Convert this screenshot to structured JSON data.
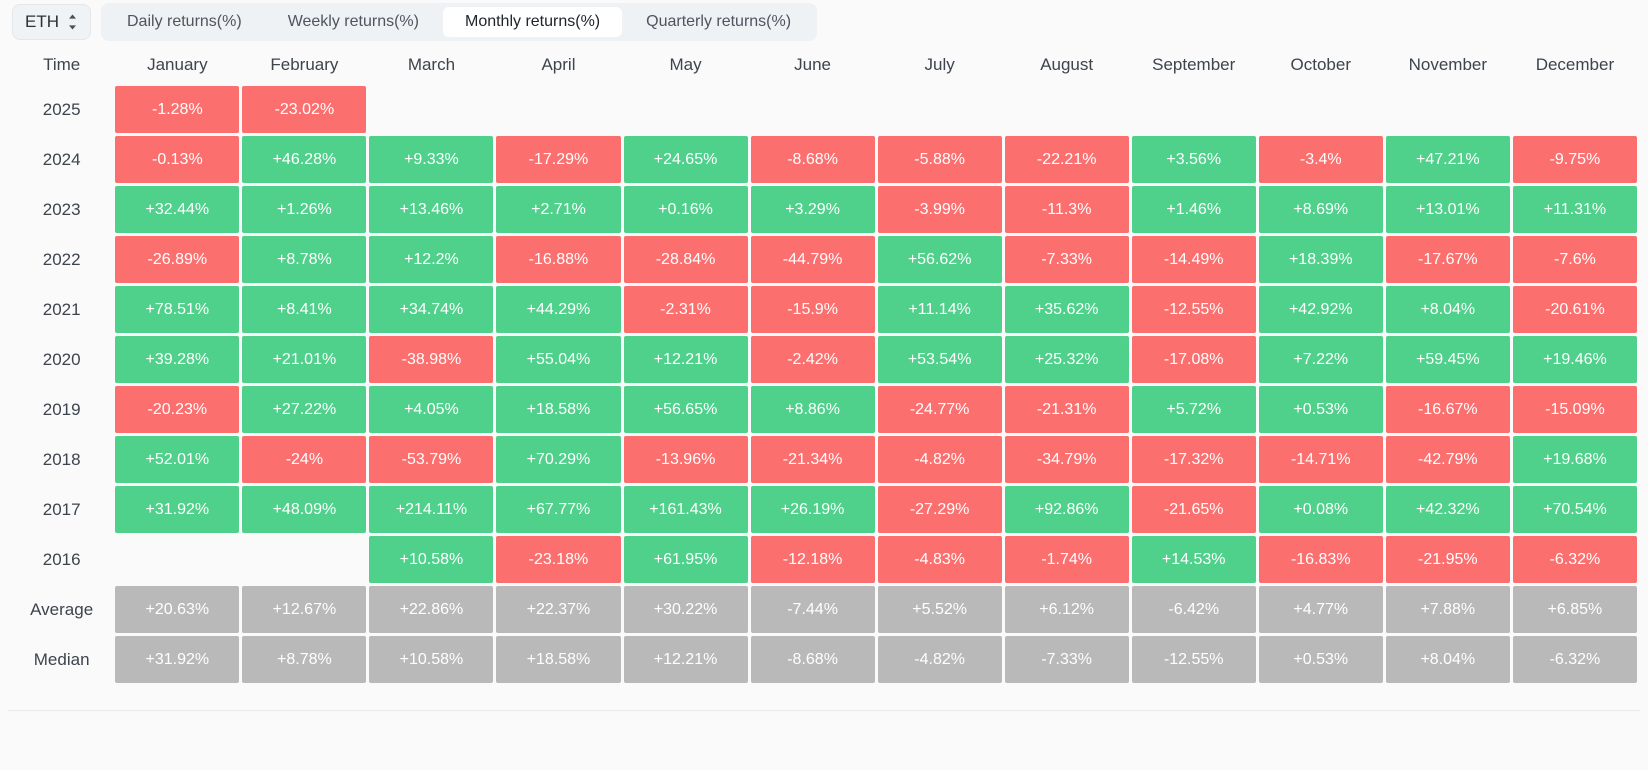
{
  "toolbar": {
    "symbol": "ETH",
    "symbol_caret_icon": "chevron-up-down-icon",
    "tabs": [
      {
        "label": "Daily returns(%)",
        "active": false
      },
      {
        "label": "Weekly returns(%)",
        "active": false
      },
      {
        "label": "Monthly returns(%)",
        "active": true
      },
      {
        "label": "Quarterly returns(%)",
        "active": false
      }
    ]
  },
  "colors": {
    "positive": "#4fd18b",
    "negative": "#fb6f6f",
    "stat": "#b9b9b9",
    "page_bg": "#fafafa",
    "tabs_bg": "#eef2f4",
    "text": "#3d444d"
  },
  "chart_data": {
    "type": "heatmap",
    "title": "Monthly returns(%)",
    "xlabel": "",
    "ylabel": "Time",
    "time_header": "Time",
    "categories": [
      "January",
      "February",
      "March",
      "April",
      "May",
      "June",
      "July",
      "August",
      "September",
      "October",
      "November",
      "December"
    ],
    "rows": [
      {
        "label": "2025",
        "kind": "year",
        "values": [
          "-1.28%",
          "-23.02%",
          "",
          "",
          "",
          "",
          "",
          "",
          "",
          "",
          "",
          ""
        ]
      },
      {
        "label": "2024",
        "kind": "year",
        "values": [
          "-0.13%",
          "+46.28%",
          "+9.33%",
          "-17.29%",
          "+24.65%",
          "-8.68%",
          "-5.88%",
          "-22.21%",
          "+3.56%",
          "-3.4%",
          "+47.21%",
          "-9.75%"
        ]
      },
      {
        "label": "2023",
        "kind": "year",
        "values": [
          "+32.44%",
          "+1.26%",
          "+13.46%",
          "+2.71%",
          "+0.16%",
          "+3.29%",
          "-3.99%",
          "-11.3%",
          "+1.46%",
          "+8.69%",
          "+13.01%",
          "+11.31%"
        ]
      },
      {
        "label": "2022",
        "kind": "year",
        "values": [
          "-26.89%",
          "+8.78%",
          "+12.2%",
          "-16.88%",
          "-28.84%",
          "-44.79%",
          "+56.62%",
          "-7.33%",
          "-14.49%",
          "+18.39%",
          "-17.67%",
          "-7.6%"
        ]
      },
      {
        "label": "2021",
        "kind": "year",
        "values": [
          "+78.51%",
          "+8.41%",
          "+34.74%",
          "+44.29%",
          "-2.31%",
          "-15.9%",
          "+11.14%",
          "+35.62%",
          "-12.55%",
          "+42.92%",
          "+8.04%",
          "-20.61%"
        ]
      },
      {
        "label": "2020",
        "kind": "year",
        "values": [
          "+39.28%",
          "+21.01%",
          "-38.98%",
          "+55.04%",
          "+12.21%",
          "-2.42%",
          "+53.54%",
          "+25.32%",
          "-17.08%",
          "+7.22%",
          "+59.45%",
          "+19.46%"
        ]
      },
      {
        "label": "2019",
        "kind": "year",
        "values": [
          "-20.23%",
          "+27.22%",
          "+4.05%",
          "+18.58%",
          "+56.65%",
          "+8.86%",
          "-24.77%",
          "-21.31%",
          "+5.72%",
          "+0.53%",
          "-16.67%",
          "-15.09%"
        ]
      },
      {
        "label": "2018",
        "kind": "year",
        "values": [
          "+52.01%",
          "-24%",
          "-53.79%",
          "+70.29%",
          "-13.96%",
          "-21.34%",
          "-4.82%",
          "-34.79%",
          "-17.32%",
          "-14.71%",
          "-42.79%",
          "+19.68%"
        ]
      },
      {
        "label": "2017",
        "kind": "year",
        "values": [
          "+31.92%",
          "+48.09%",
          "+214.11%",
          "+67.77%",
          "+161.43%",
          "+26.19%",
          "-27.29%",
          "+92.86%",
          "-21.65%",
          "+0.08%",
          "+42.32%",
          "+70.54%"
        ]
      },
      {
        "label": "2016",
        "kind": "year",
        "values": [
          "",
          "",
          "+10.58%",
          "-23.18%",
          "+61.95%",
          "-12.18%",
          "-4.83%",
          "-1.74%",
          "+14.53%",
          "-16.83%",
          "-21.95%",
          "-6.32%"
        ]
      },
      {
        "label": "Average",
        "kind": "stat",
        "values": [
          "+20.63%",
          "+12.67%",
          "+22.86%",
          "+22.37%",
          "+30.22%",
          "-7.44%",
          "+5.52%",
          "+6.12%",
          "-6.42%",
          "+4.77%",
          "+7.88%",
          "+6.85%"
        ]
      },
      {
        "label": "Median",
        "kind": "stat",
        "values": [
          "+31.92%",
          "+8.78%",
          "+10.58%",
          "+18.58%",
          "+12.21%",
          "-8.68%",
          "-4.82%",
          "-7.33%",
          "-12.55%",
          "+0.53%",
          "+8.04%",
          "-6.32%"
        ]
      }
    ]
  }
}
